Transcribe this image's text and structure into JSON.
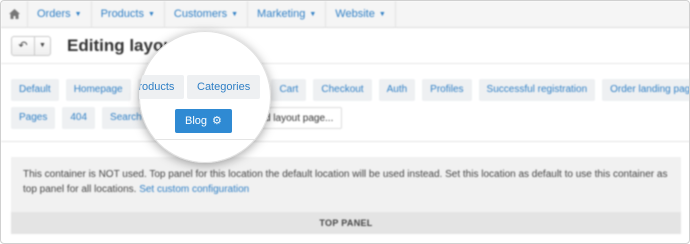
{
  "topnav": {
    "items": [
      {
        "label": "Orders"
      },
      {
        "label": "Products"
      },
      {
        "label": "Customers"
      },
      {
        "label": "Marketing"
      },
      {
        "label": "Website"
      }
    ]
  },
  "header": {
    "title": "Editing layout: Main"
  },
  "layout_tabs": {
    "row1": [
      "Default",
      "Homepage",
      "Products",
      "Categories",
      "Cart",
      "Checkout",
      "Auth",
      "Profiles",
      "Successful registration",
      "Order landing page"
    ],
    "row2": [
      "Pages",
      "404",
      "Search results",
      "Blog",
      "Add layout page..."
    ],
    "active": "Blog"
  },
  "container": {
    "notice": "This container is NOT used. Top panel for this location the default location will be used instead. Set this location as default to use this container as top panel for all locations.",
    "link": "Set custom configuration",
    "panel_label": "TOP PANEL"
  },
  "colors": {
    "accent": "#2f8ad3",
    "link": "#2f7fc5"
  }
}
